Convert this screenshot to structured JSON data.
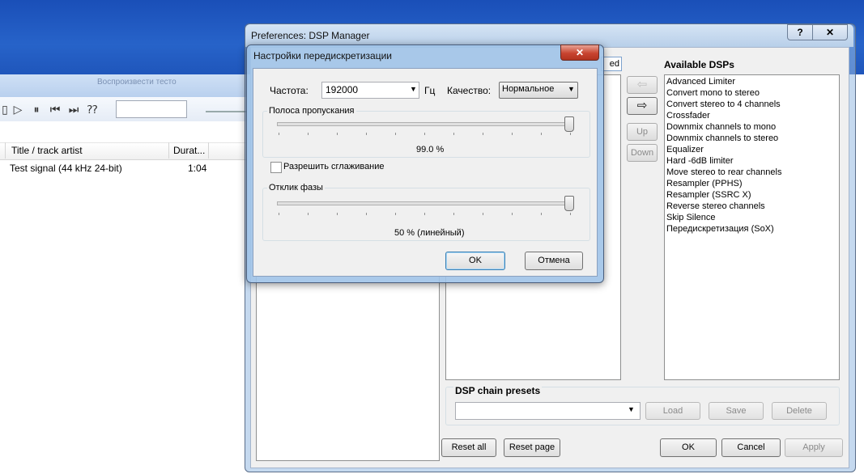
{
  "background_player": {
    "menubar_text": "Воспроизвести тесто",
    "columns": {
      "title": "Title / track artist",
      "duration": "Durat..."
    },
    "row": {
      "title": "Test signal (44 kHz 24-bit)",
      "duration": "1:04"
    }
  },
  "dsp_manager": {
    "title": "Preferences: DSP Manager",
    "help_label": "?",
    "close_label": "✕",
    "active_header_fragment": "ed",
    "available_title": "Available DSPs",
    "available_dsps": [
      "Advanced Limiter",
      "Convert mono to stereo",
      "Convert stereo to 4 channels",
      "Crossfader",
      "Downmix channels to mono",
      "Downmix channels to stereo",
      "Equalizer",
      "Hard -6dB limiter",
      "Move stereo to rear channels",
      "Resampler (PPHS)",
      "Resampler (SSRC X)",
      "Reverse stereo channels",
      "Skip Silence",
      "Передискретизация (SoX)"
    ],
    "mid_buttons": {
      "left_arrow": "⇦",
      "right_arrow": "⇨",
      "up": "Up",
      "down": "Down"
    },
    "presets": {
      "title": "DSP chain presets",
      "load": "Load",
      "save": "Save",
      "delete": "Delete"
    },
    "buttons": {
      "reset_all": "Reset all",
      "reset_page": "Reset page",
      "ok": "OK",
      "cancel": "Cancel",
      "apply": "Apply"
    }
  },
  "resampler": {
    "title": "Настройки передискретизации",
    "close_label": "✕",
    "frequency_label": "Частота:",
    "frequency_value": "192000",
    "hz_label": "Гц",
    "quality_label": "Качество:",
    "quality_value": "Нормальное",
    "bandwidth_label": "Полоса пропускания",
    "bandwidth_value": "99.0 %",
    "bandwidth_slider_level": 0.99,
    "smoothing_label": "Разрешить сглаживание",
    "smoothing_checked": false,
    "phase_label": "Отклик фазы",
    "phase_value": "50 % (линейный)",
    "phase_slider_level": 1.0,
    "ok": "OK",
    "cancel": "Отмена"
  }
}
